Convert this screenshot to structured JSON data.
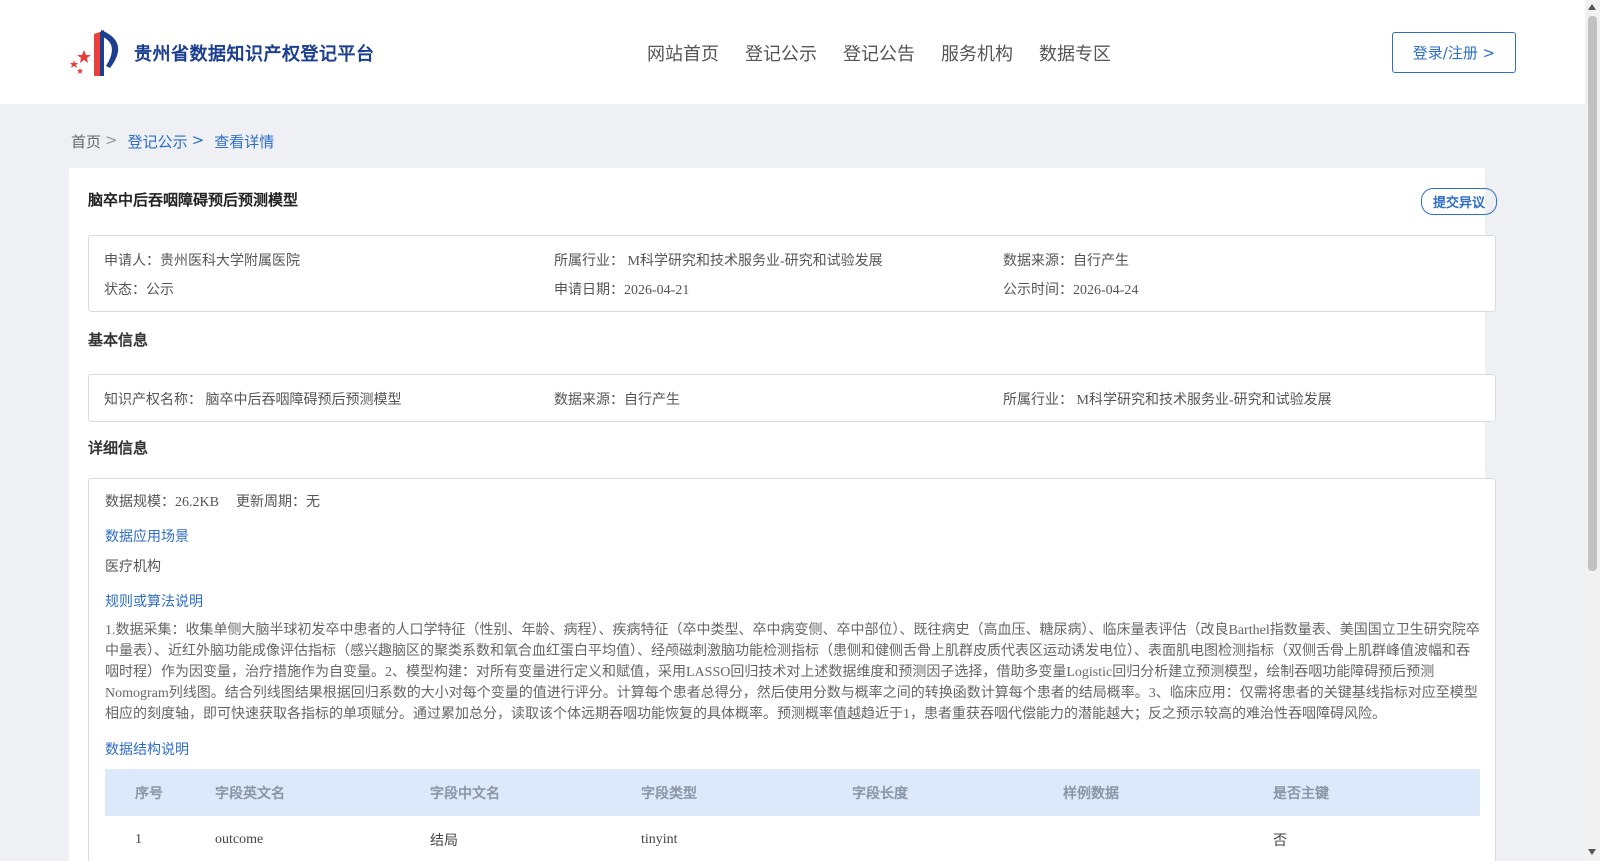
{
  "header": {
    "logo_text": "贵州省数据知识产权登记平台",
    "nav": [
      "网站首页",
      "登记公示",
      "登记公告",
      "服务机构",
      "数据专区"
    ],
    "login_label": "登录/注册 >"
  },
  "breadcrumb": {
    "home": "首页",
    "sep": ">",
    "level1": "登记公示",
    "level2": "查看详情"
  },
  "record": {
    "title": "脑卒中后吞咽障碍预后预测模型",
    "objection_label": "提交异议",
    "summary": {
      "applicant": "申请人：贵州医科大学附属医院",
      "industry": "所属行业： M科学研究和技术服务业-研究和试验发展",
      "source": "数据来源：自行产生",
      "status": "状态：公示",
      "apply_date": "申请日期：2026-04-21",
      "publish_date": "公示时间：2026-04-24"
    }
  },
  "basic": {
    "section_title": "基本信息",
    "ip_name": "知识产权名称： 脑卒中后吞咽障碍预后预测模型",
    "source": "数据来源：自行产生",
    "industry": "所属行业： M科学研究和技术服务业-研究和试验发展"
  },
  "detail": {
    "section_title": "详细信息",
    "scale": "数据规模：26.2KB",
    "update_cycle": "更新周期：无",
    "scenario_heading": "数据应用场景",
    "scenario_value": "医疗机构",
    "algo_heading": "规则或算法说明",
    "algo_text": "1.数据采集：收集单侧大脑半球初发卒中患者的人口学特征（性别、年龄、病程）、疾病特征（卒中类型、卒中病变侧、卒中部位）、既往病史（高血压、糖尿病）、临床量表评估（改良Barthel指数量表、美国国立卫生研究院卒中量表）、近红外脑功能成像评估指标（感兴趣脑区的聚类系数和氧合血红蛋白平均值）、经颅磁刺激脑功能检测指标（患侧和健侧舌骨上肌群皮质代表区运动诱发电位）、表面肌电图检测指标（双侧舌骨上肌群峰值波幅和吞咽时程）作为因变量，治疗措施作为自变量。2、模型构建：对所有变量进行定义和赋值，采用LASSO回归技术对上述数据维度和预测因子选择，借助多变量Logistic回归分析建立预测模型，绘制吞咽功能障碍预后预测Nomogram列线图。结合列线图结果根据回归系数的大小对每个变量的值进行评分。计算每个患者总得分，然后使用分数与概率之间的转换函数计算每个患者的结局概率。3、临床应用：仅需将患者的关键基线指标对应至模型相应的刻度轴，即可快速获取各指标的单项赋分。通过累加总分，读取该个体远期吞咽功能恢复的具体概率。预测概率值越趋近于1，患者重获吞咽代偿能力的潜能越大；反之预示较高的难治性吞咽障碍风险。",
    "structure_heading": "数据结构说明",
    "table_headers": [
      "序号",
      "字段英文名",
      "字段中文名",
      "字段类型",
      "字段长度",
      "样例数据",
      "是否主键"
    ],
    "table_rows": [
      [
        "1",
        "outcome",
        "结局",
        "tinyint",
        "",
        "",
        "否"
      ]
    ]
  }
}
